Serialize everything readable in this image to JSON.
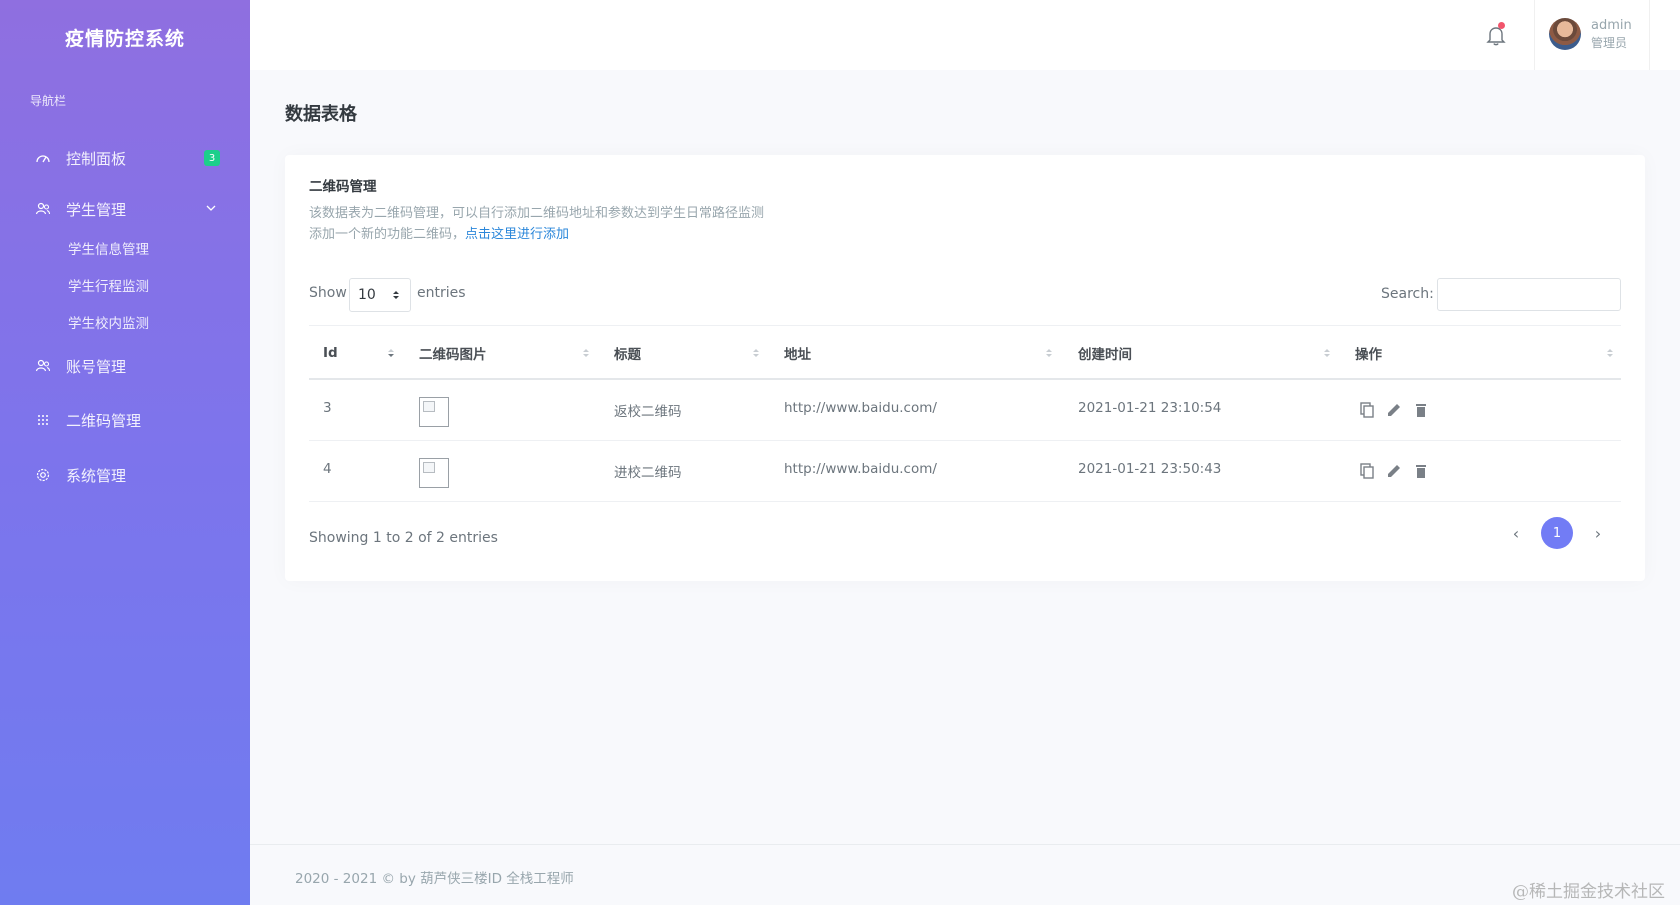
{
  "sidebar": {
    "brand": "疫情防控系统",
    "heading": "导航栏",
    "items": [
      {
        "label": "控制面板",
        "icon": "dashboard-icon",
        "badge": "3"
      },
      {
        "label": "学生管理",
        "icon": "users-icon"
      },
      {
        "label": "账号管理",
        "icon": "account-icon"
      },
      {
        "label": "二维码管理",
        "icon": "grid-icon"
      },
      {
        "label": "系统管理",
        "icon": "gear-icon"
      }
    ],
    "sub_items": [
      "学生信息管理",
      "学生行程监测",
      "学生校内监测"
    ]
  },
  "topbar": {
    "user_name": "admin",
    "user_role": "管理员"
  },
  "page": {
    "title": "数据表格"
  },
  "card": {
    "title": "二维码管理",
    "desc_line1": "该数据表为二维码管理，可以自行添加二维码地址和参数达到学生日常路径监测",
    "desc_line2": "添加一个新的功能二维码，",
    "desc_link": "点击这里进行添加"
  },
  "table_controls": {
    "show_label": "Show",
    "page_size": "10",
    "entries_label": "entries",
    "search_label": "Search:",
    "search_value": ""
  },
  "table": {
    "headers": [
      "Id",
      "二维码图片",
      "标题",
      "地址",
      "创建时间",
      "操作"
    ],
    "rows": [
      {
        "id": "3",
        "title": "返校二维码",
        "url": "http://www.baidu.com/",
        "created": "2021-01-21 23:10:54"
      },
      {
        "id": "4",
        "title": "进校二维码",
        "url": "http://www.baidu.com/",
        "created": "2021-01-21 23:50:43"
      }
    ]
  },
  "pagination": {
    "info": "Showing 1 to 2 of 2 entries",
    "prev": "‹",
    "current": "1",
    "next": "›"
  },
  "footer": {
    "text": "2020 - 2021 © by 葫芦侠三楼ID 全栈工程师"
  },
  "watermark": "@稀土掘金技术社区",
  "colors": {
    "sidebar_top": "#8f6fe0",
    "sidebar_bottom": "#6f7cf0",
    "accent": "#727cf5",
    "badge": "#1ccf8b",
    "link": "#2b87da",
    "notify_dot": "#f1556c"
  }
}
